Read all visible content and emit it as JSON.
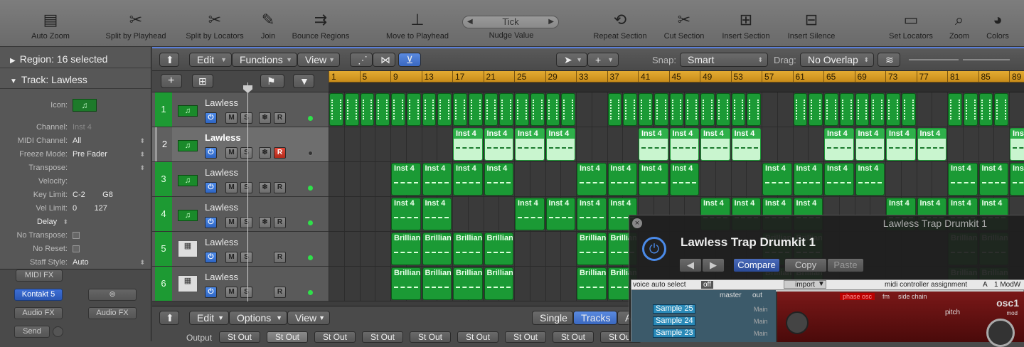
{
  "toolbar": {
    "items": [
      {
        "label": "Auto Zoom",
        "icon": "auto-zoom-icon",
        "glyph": "▤"
      },
      {
        "label": "Split by Playhead",
        "icon": "scissors-icon",
        "glyph": "✂"
      },
      {
        "label": "Split by Locators",
        "icon": "scissors-bracket-icon",
        "glyph": "✂"
      },
      {
        "label": "Join",
        "icon": "glue-icon",
        "glyph": "✎"
      },
      {
        "label": "Bounce Regions",
        "icon": "bounce-icon",
        "glyph": "⇉"
      },
      {
        "label": "Move to Playhead",
        "icon": "joystick-icon",
        "glyph": "⊥"
      },
      {
        "label": "Repeat Section",
        "icon": "repeat-icon",
        "glyph": "⟲"
      },
      {
        "label": "Cut Section",
        "icon": "cut-section-icon",
        "glyph": "✂"
      },
      {
        "label": "Insert Section",
        "icon": "insert-section-icon",
        "glyph": "⊞"
      },
      {
        "label": "Insert Silence",
        "icon": "insert-silence-icon",
        "glyph": "⊟"
      },
      {
        "label": "Set Locators",
        "icon": "locators-icon",
        "glyph": "▭"
      },
      {
        "label": "Zoom",
        "icon": "magnifier-icon",
        "glyph": "⌕"
      },
      {
        "label": "Colors",
        "icon": "palette-icon",
        "glyph": "◕"
      }
    ],
    "nudge_value": "Tick",
    "nudge_label": "Nudge Value"
  },
  "inspector": {
    "region_header": "Region: 16 selected",
    "track_header": "Track:  Lawless",
    "icon_label": "Icon:",
    "params": [
      {
        "key": "Channel:",
        "value": "Inst 4",
        "dim": true
      },
      {
        "key": "MIDI Channel:",
        "value": "All"
      },
      {
        "key": "Freeze Mode:",
        "value": "Pre Fader"
      },
      {
        "key": "Transpose:",
        "value": ""
      },
      {
        "key": "Velocity:",
        "value": ""
      },
      {
        "key": "Key Limit:",
        "value": "C-2        G8"
      },
      {
        "key": "Vel Limit:",
        "value": "0        127"
      },
      {
        "key": "",
        "value": "Delay"
      },
      {
        "key": "No Transpose:",
        "value": ""
      },
      {
        "key": "No Reset:",
        "value": ""
      },
      {
        "key": "Staff Style:",
        "value": "Auto"
      }
    ],
    "slots": {
      "midi_fx": "MIDI FX",
      "instrument": "Kontakt 5",
      "audio_fx_left": "Audio FX",
      "audio_fx_right": "Audio FX",
      "send": "Send"
    }
  },
  "localbar": {
    "edit": "Edit",
    "functions": "Functions",
    "view": "View",
    "snap_label": "Snap:",
    "snap_value": "Smart",
    "drag_label": "Drag:",
    "drag_value": "No Overlap"
  },
  "ruler": {
    "bars": [
      "1",
      "5",
      "9",
      "13",
      "17",
      "21",
      "25",
      "29",
      "33",
      "37",
      "41",
      "45",
      "49",
      "53",
      "57",
      "61",
      "65",
      "69",
      "73",
      "77",
      "81",
      "85",
      "89"
    ]
  },
  "tracks": [
    {
      "num": "1",
      "name": "Lawless",
      "type": "inst",
      "selected": false,
      "rec": false,
      "led": true
    },
    {
      "num": "2",
      "name": "Lawless",
      "type": "inst",
      "selected": true,
      "rec": true,
      "led": false
    },
    {
      "num": "3",
      "name": "Lawless",
      "type": "inst",
      "selected": false,
      "rec": false,
      "led": true
    },
    {
      "num": "4",
      "name": "Lawless",
      "type": "inst",
      "selected": false,
      "rec": false,
      "led": true
    },
    {
      "num": "5",
      "name": "Lawless",
      "type": "kit",
      "selected": false,
      "rec": false,
      "led": true
    },
    {
      "num": "6",
      "name": "Lawless",
      "type": "kit",
      "selected": false,
      "rec": false,
      "led": true
    }
  ],
  "regions": {
    "row2_label": "Inst 4",
    "row3_label": "Inst 4",
    "row4_label": "Inst 4",
    "row5_label": "Brillian",
    "row6_label": "Brillian"
  },
  "mixer": {
    "edit": "Edit",
    "options": "Options",
    "view": "View",
    "single": "Single",
    "tracks": "Tracks",
    "a": "A",
    "output_label": "Output",
    "outputs": [
      "St Out",
      "St Out",
      "St Out",
      "St Out",
      "St Out",
      "St Out",
      "St Out",
      "St Out",
      "St Out"
    ]
  },
  "plugin": {
    "window_title": "Lawless Trap Drumkit 1",
    "preset_name": "Lawless Trap Drumkit 1",
    "compare": "Compare",
    "copy": "Copy",
    "paste": "Paste"
  },
  "kontakt": {
    "voice_auto_select": "voice auto select",
    "off": "off",
    "import": "import",
    "midi_assign": "midi controller assignment",
    "a": "A",
    "modw": "1 ModW",
    "master": "master",
    "out": "out",
    "samples": [
      "Sample 25",
      "Sample 24",
      "Sample 23"
    ],
    "main": "Main",
    "tabs": [
      "phase osc",
      "fm",
      "side chain"
    ],
    "osc": "osc1",
    "pitch": "pitch",
    "mod": "mod"
  }
}
